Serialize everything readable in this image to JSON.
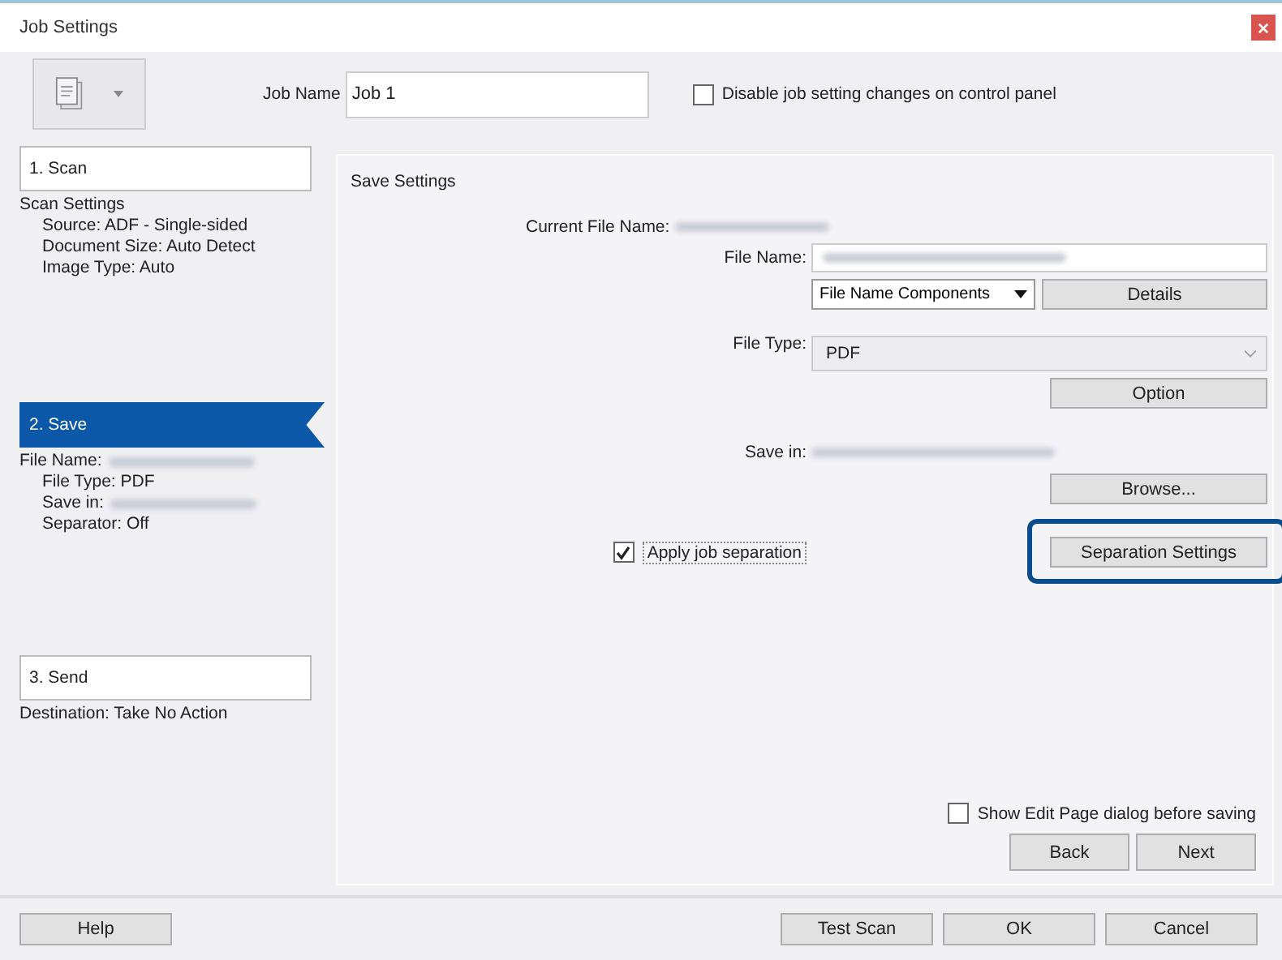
{
  "window": {
    "title": "Job Settings"
  },
  "toolbar": {
    "job_name_label": "Job Name",
    "job_name_value": "Job 1",
    "disable_changes": {
      "label": "Disable job setting changes on control panel",
      "checked": false
    }
  },
  "steps": [
    {
      "label": "1. Scan",
      "selected": false,
      "details": [
        {
          "text": "Scan Settings",
          "blurred": false,
          "children": [
            {
              "text": "Source: ADF - Single-sided",
              "blurred": false
            },
            {
              "text": "Document Size: Auto Detect",
              "blurred": false
            },
            {
              "text": "Image Type: Auto",
              "blurred": false
            }
          ]
        }
      ]
    },
    {
      "label": "2. Save",
      "selected": true,
      "details": [
        {
          "text": "File Name:",
          "blurred": true,
          "children": [
            {
              "text": "File Type: PDF",
              "blurred": false
            },
            {
              "text": "Save in:",
              "blurred": true
            },
            {
              "text": "Separator: Off",
              "blurred": false
            }
          ]
        }
      ]
    },
    {
      "label": "3. Send",
      "selected": false,
      "details": [
        {
          "text": "Destination: Take No Action",
          "blurred": false
        }
      ]
    }
  ],
  "save_settings": {
    "title": "Save Settings",
    "current_file_name": {
      "label": "Current File Name:",
      "blurred": true
    },
    "file_name": {
      "label": "File Name:",
      "blurred": true
    },
    "components_dropdown": "File Name Components",
    "details_button": "Details",
    "file_type": {
      "label": "File Type:",
      "value": "PDF"
    },
    "option_button": "Option",
    "save_in": {
      "label": "Save in:",
      "blurred": true
    },
    "browse_button": "Browse...",
    "apply_separation": {
      "label": "Apply job separation",
      "checked": true
    },
    "separation_button": {
      "label": "Separation Settings",
      "highlighted": true
    },
    "show_edit_page": {
      "label": "Show Edit Page dialog before saving",
      "checked": false
    },
    "nav_buttons": [
      "Back",
      "Next"
    ]
  },
  "footer": {
    "help_button": "Help",
    "buttons": [
      "Test Scan",
      "OK",
      "Cancel"
    ]
  }
}
